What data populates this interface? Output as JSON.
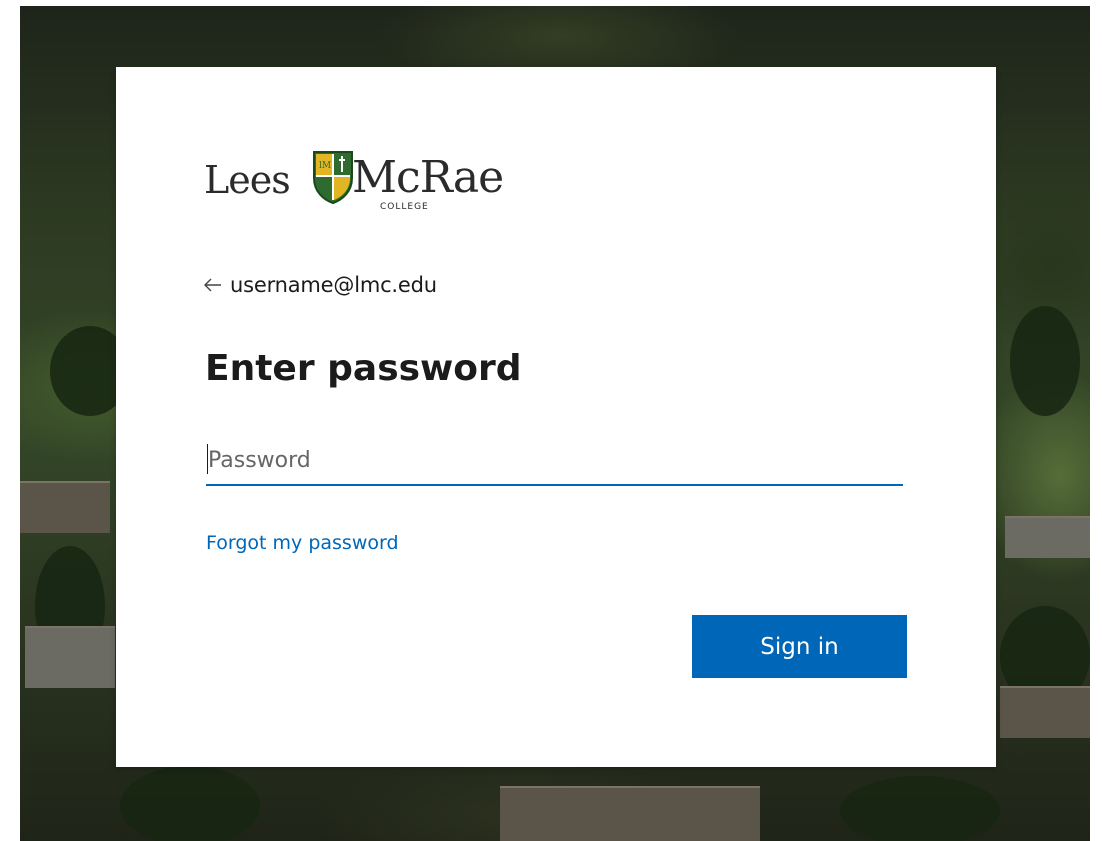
{
  "brand": {
    "logo_text_left": "Lees",
    "logo_text_right": "McRae",
    "logo_subtext": "COLLEGE",
    "logo_shield_colors": [
      "#2f6b2f",
      "#e2b523",
      "#1a4a1a",
      "#ffffff"
    ]
  },
  "account": {
    "back_icon": "arrow-left-icon",
    "email": "username@lmc.edu"
  },
  "form": {
    "title": "Enter password",
    "password_placeholder": "Password",
    "password_value": "",
    "forgot_link": "Forgot my password",
    "submit_label": "Sign in"
  },
  "colors": {
    "accent": "#0067b8",
    "text": "#1b1b1b",
    "card_bg": "#ffffff"
  }
}
